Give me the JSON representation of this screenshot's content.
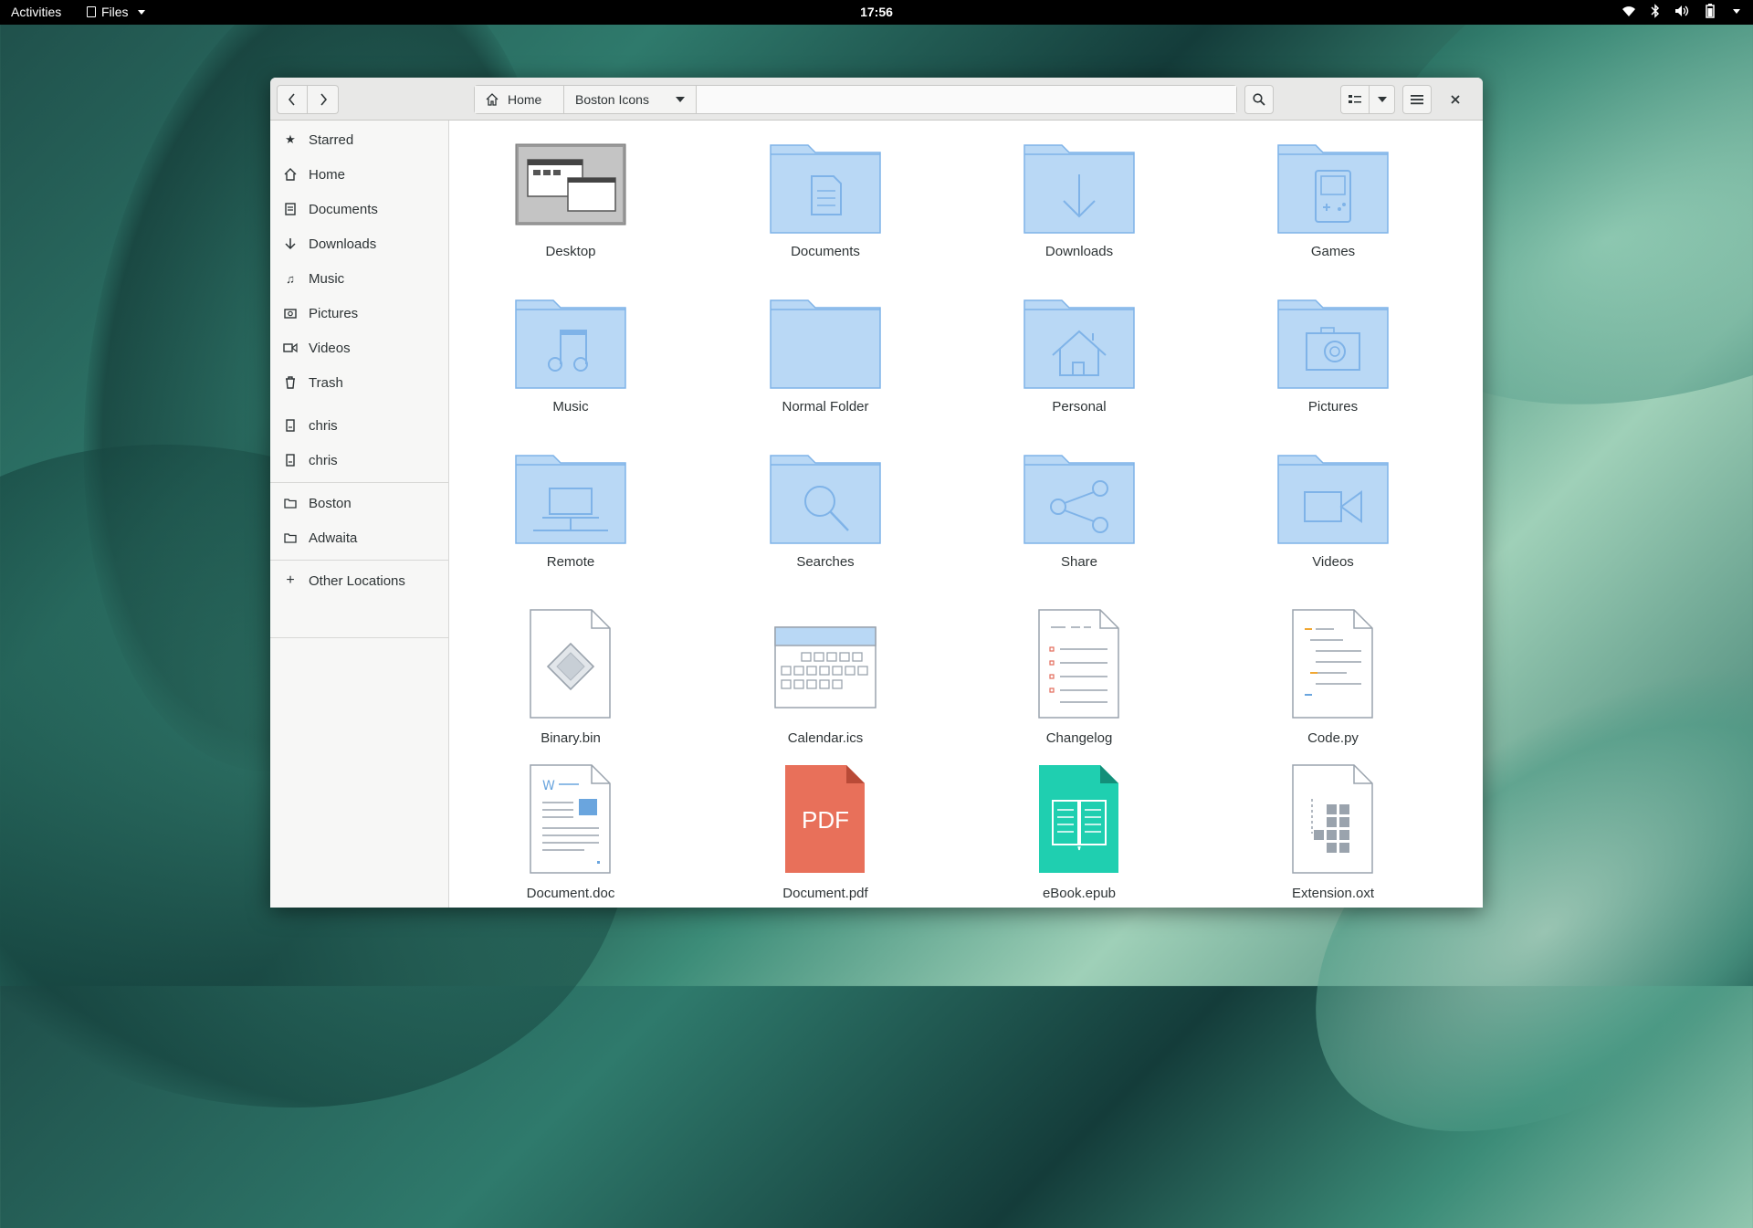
{
  "topbar": {
    "activities": "Activities",
    "app_menu": "Files",
    "clock": "17:56"
  },
  "window": {
    "nav": {
      "back_icon": "chevron-left-icon",
      "forward_icon": "chevron-right-icon"
    },
    "pathbar": {
      "home": "Home",
      "current": "Boston Icons"
    },
    "buttons": {
      "search_icon": "search-icon",
      "view_icon": "list-view-icon",
      "menu_icon": "hamburger-menu-icon",
      "close_icon": "close-icon"
    }
  },
  "sidebar": {
    "places": [
      {
        "label": "Starred",
        "icon": "star-icon"
      },
      {
        "label": "Home",
        "icon": "home-icon"
      },
      {
        "label": "Documents",
        "icon": "documents-icon"
      },
      {
        "label": "Downloads",
        "icon": "download-icon"
      },
      {
        "label": "Music",
        "icon": "music-icon"
      },
      {
        "label": "Pictures",
        "icon": "camera-icon"
      },
      {
        "label": "Videos",
        "icon": "video-icon"
      },
      {
        "label": "Trash",
        "icon": "trash-icon"
      }
    ],
    "devices": [
      {
        "label": "chris",
        "icon": "drive-icon"
      },
      {
        "label": "chris",
        "icon": "drive-icon"
      }
    ],
    "bookmarks": [
      {
        "label": "Boston",
        "icon": "folder-icon"
      },
      {
        "label": "Adwaita",
        "icon": "folder-icon"
      }
    ],
    "other": {
      "label": "Other Locations",
      "icon": "plus-icon"
    }
  },
  "files": [
    {
      "name": "Desktop",
      "icon": "desktop-folder-icon"
    },
    {
      "name": "Documents",
      "icon": "documents-folder-icon"
    },
    {
      "name": "Downloads",
      "icon": "downloads-folder-icon"
    },
    {
      "name": "Games",
      "icon": "games-folder-icon"
    },
    {
      "name": "Music",
      "icon": "music-folder-icon"
    },
    {
      "name": "Normal Folder",
      "icon": "folder-icon"
    },
    {
      "name": "Personal",
      "icon": "home-folder-icon"
    },
    {
      "name": "Pictures",
      "icon": "pictures-folder-icon"
    },
    {
      "name": "Remote",
      "icon": "remote-folder-icon"
    },
    {
      "name": "Searches",
      "icon": "search-folder-icon"
    },
    {
      "name": "Share",
      "icon": "share-folder-icon"
    },
    {
      "name": "Videos",
      "icon": "videos-folder-icon"
    },
    {
      "name": "Binary.bin",
      "icon": "binary-file-icon"
    },
    {
      "name": "Calendar.ics",
      "icon": "calendar-file-icon"
    },
    {
      "name": "Changelog",
      "icon": "changelog-file-icon"
    },
    {
      "name": "Code.py",
      "icon": "code-file-icon"
    },
    {
      "name": "Document.doc",
      "icon": "doc-file-icon"
    },
    {
      "name": "Document.pdf",
      "icon": "pdf-file-icon",
      "badge": "PDF"
    },
    {
      "name": "eBook.epub",
      "icon": "ebook-file-icon"
    },
    {
      "name": "Extension.oxt",
      "icon": "extension-file-icon"
    }
  ],
  "colors": {
    "folder_fill": "#b9d8f5",
    "folder_stroke": "#7fb3e8",
    "pdf_red": "#e8705a",
    "epub_teal": "#1fcfb0"
  }
}
